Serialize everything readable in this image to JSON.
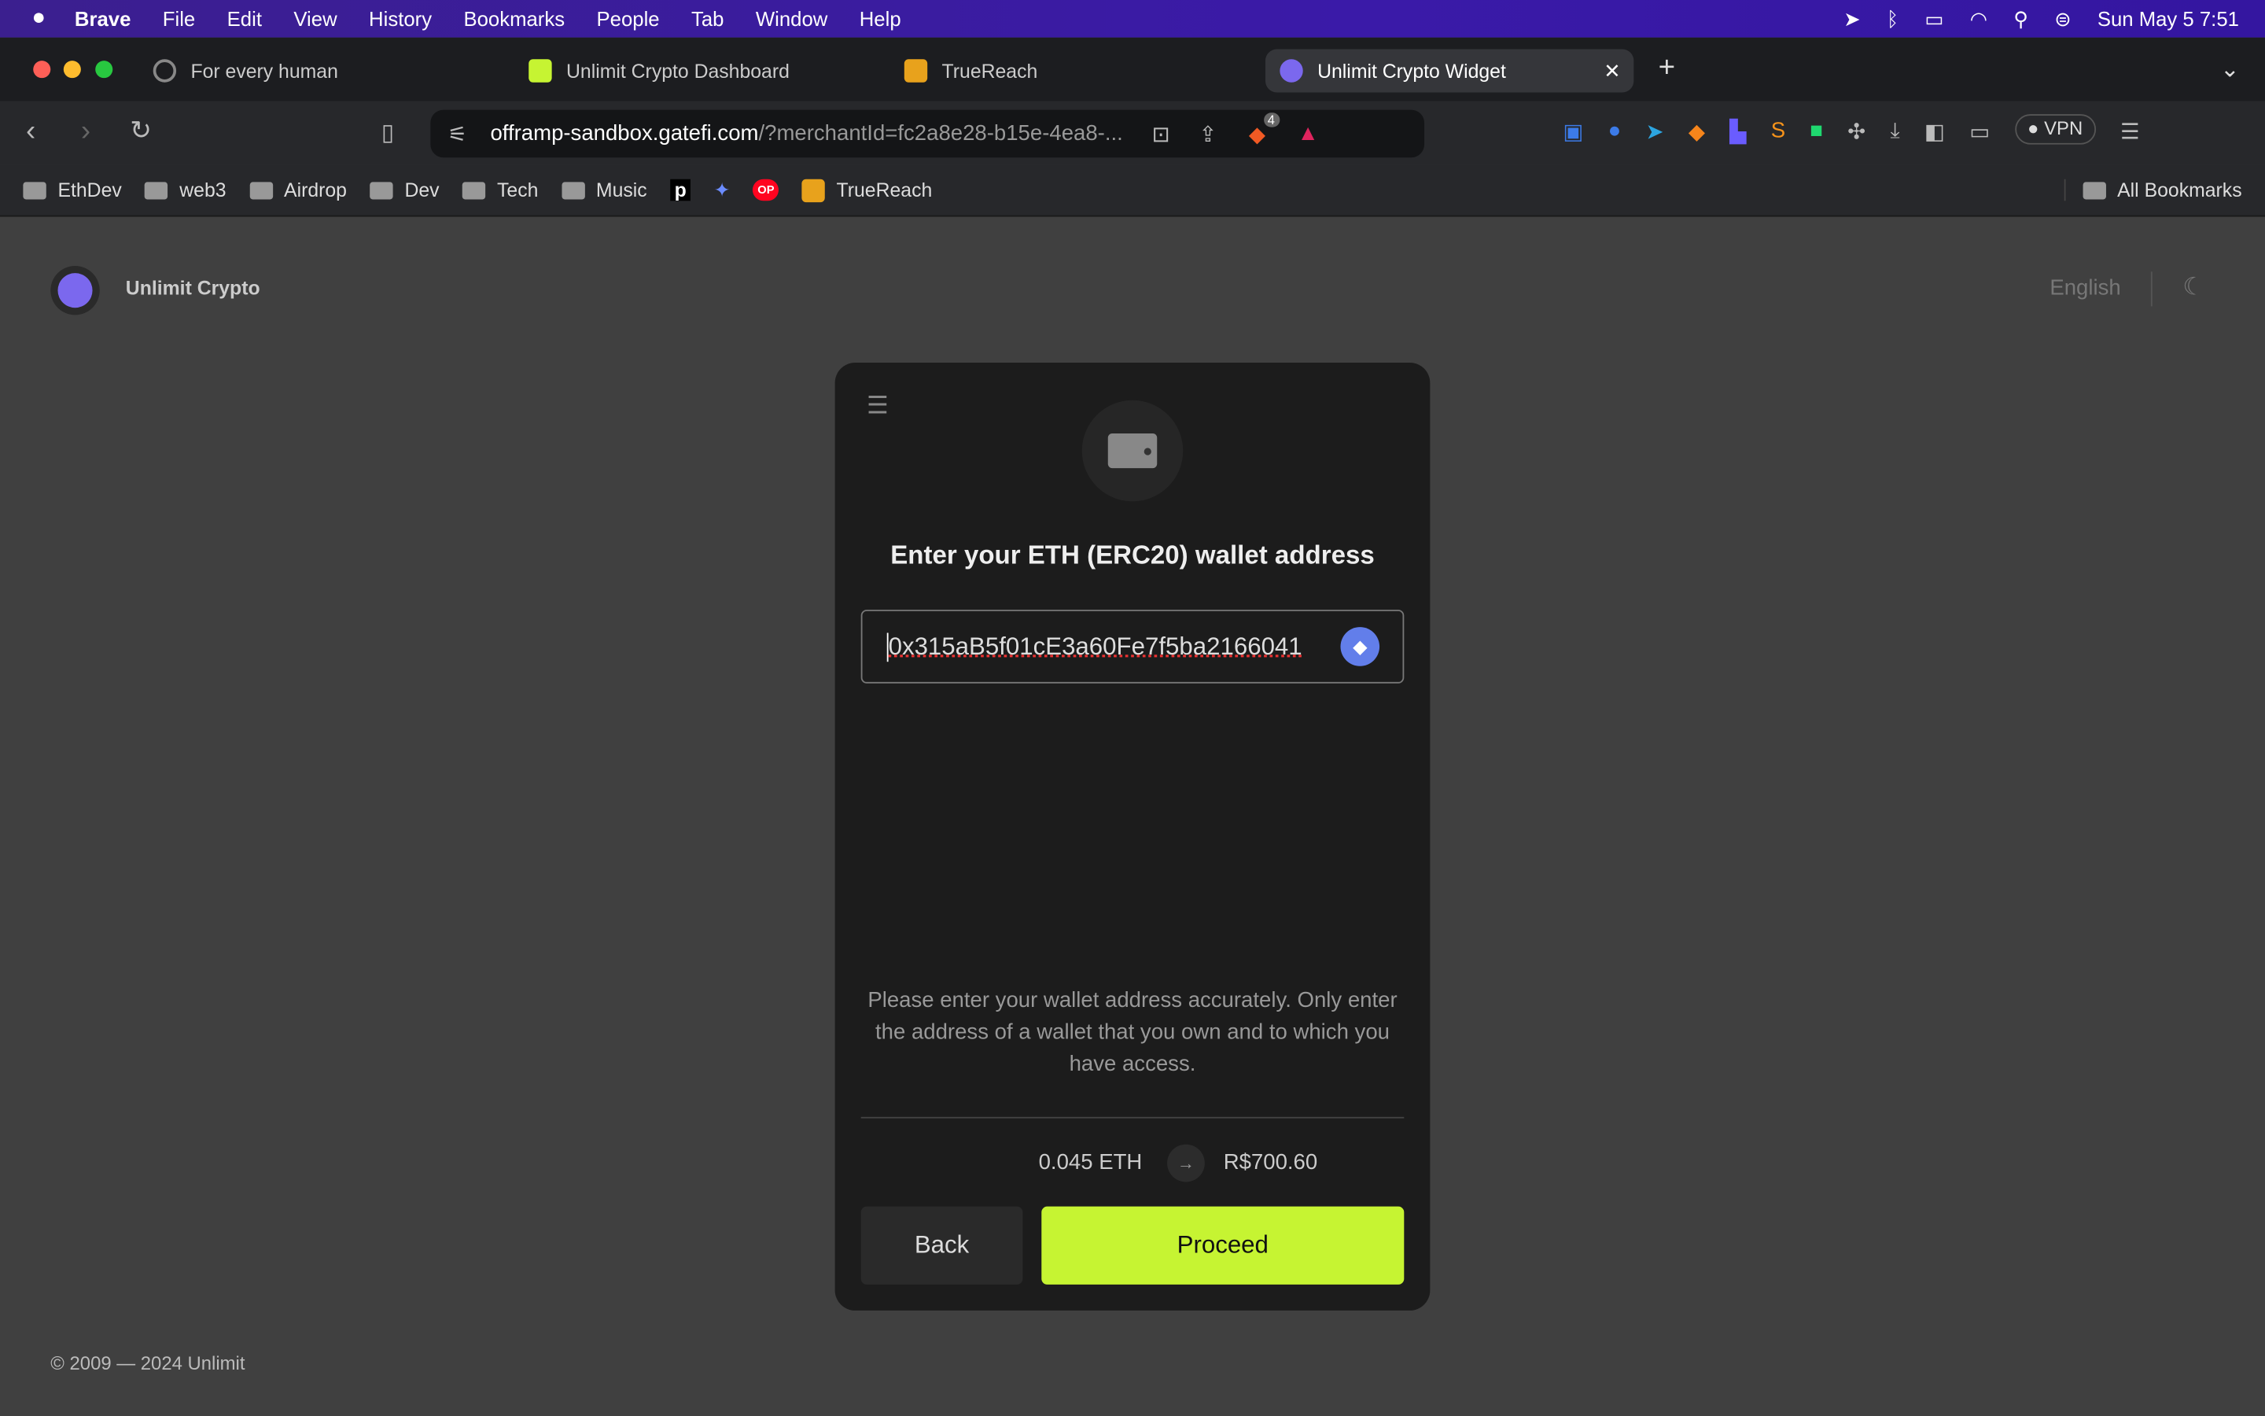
{
  "menubar": {
    "app": "Brave",
    "items": [
      "File",
      "Edit",
      "View",
      "History",
      "Bookmarks",
      "People",
      "Tab",
      "Window",
      "Help"
    ],
    "datetime": "Sun May 5  7:51"
  },
  "tabs": [
    {
      "title": "For every human",
      "active": false
    },
    {
      "title": "Unlimit Crypto Dashboard",
      "active": false
    },
    {
      "title": "TrueReach",
      "active": false
    },
    {
      "title": "Unlimit Crypto Widget",
      "active": true
    }
  ],
  "address": {
    "host": "offramp-sandbox.gatefi.com",
    "path": "/?merchantId=fc2a8e28-b15e-4ea8-...",
    "shields_count": "4"
  },
  "vpn_label": "VPN",
  "bookmarks": {
    "items": [
      "EthDev",
      "web3",
      "Airdrop",
      "Dev",
      "Tech",
      "Music"
    ],
    "truereach": "TrueReach",
    "all": "All Bookmarks"
  },
  "page": {
    "brand": "Unlimit Crypto",
    "language": "English",
    "footer": "© 2009 — 2024 Unlimit"
  },
  "widget": {
    "title": "Enter your ETH (ERC20) wallet address",
    "wallet_value": "0x315aB5f01cE3a60Fe7f5ba2166041",
    "notice": "Please enter your wallet address accurately. Only enter the address of a wallet that you own and to which you have access.",
    "from_amount": "0.045 ETH",
    "to_amount": "R$700.60",
    "back_label": "Back",
    "proceed_label": "Proceed",
    "accent": "#c6f432"
  }
}
